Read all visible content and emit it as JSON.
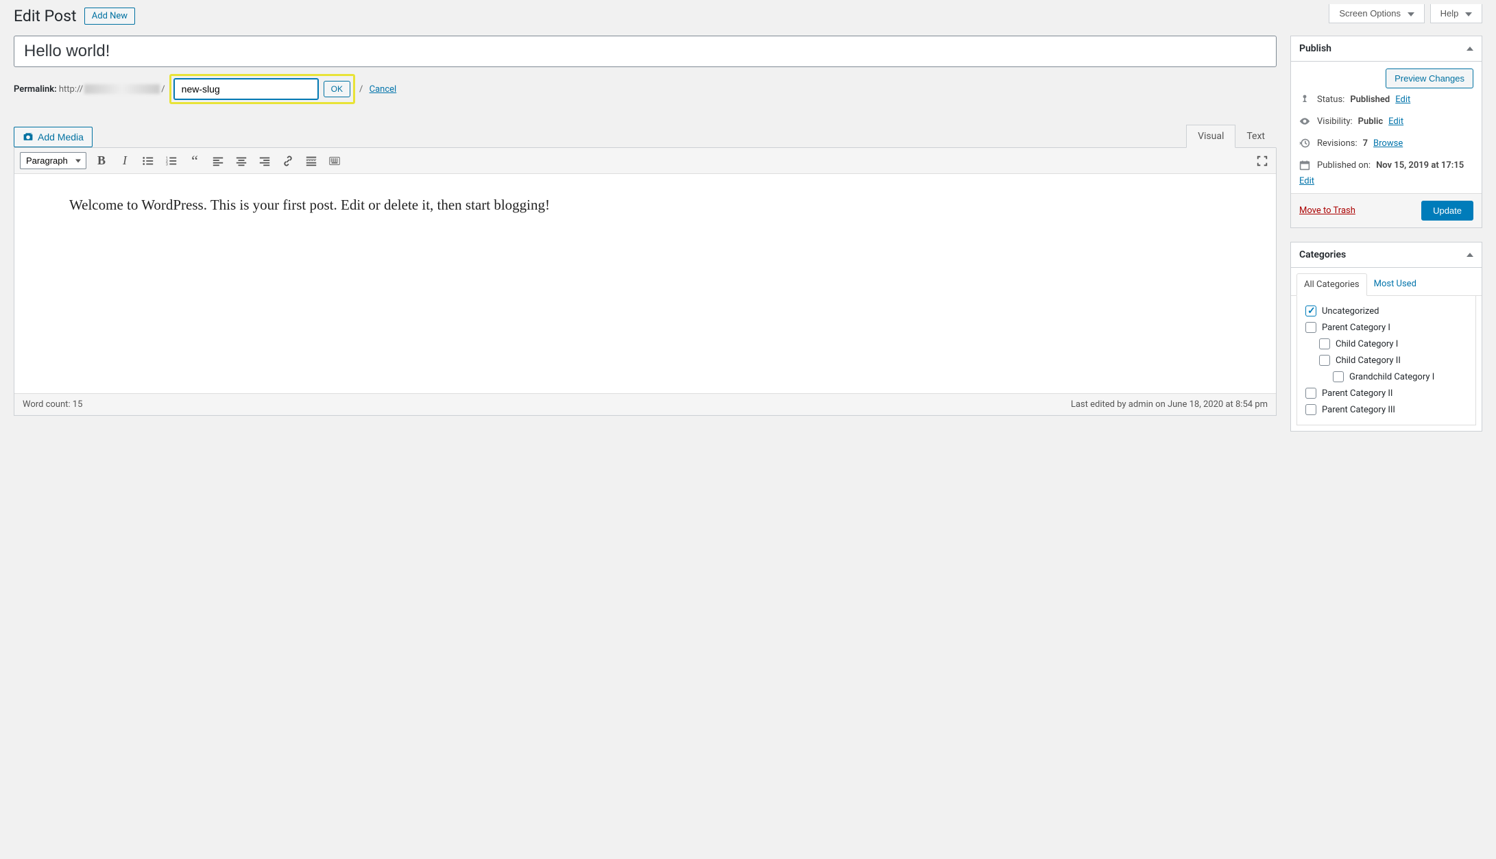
{
  "top": {
    "screen_options": "Screen Options",
    "help": "Help"
  },
  "header": {
    "title": "Edit Post",
    "add_new": "Add New"
  },
  "post": {
    "title": "Hello world!",
    "permalink_label": "Permalink:",
    "permalink_prefix": "http://",
    "slug_value": "new-slug",
    "ok": "OK",
    "cancel": "Cancel"
  },
  "editor": {
    "add_media": "Add Media",
    "tab_visual": "Visual",
    "tab_text": "Text",
    "format_select": "Paragraph",
    "content": "Welcome to WordPress. This is your first post. Edit or delete it, then start blogging!"
  },
  "status_bar": {
    "word_count_label": "Word count:",
    "word_count": "15",
    "last_edited": "Last edited by admin on June 18, 2020 at 8:54 pm"
  },
  "publish": {
    "box_title": "Publish",
    "preview": "Preview Changes",
    "status_label": "Status:",
    "status_value": "Published",
    "edit": "Edit",
    "visibility_label": "Visibility:",
    "visibility_value": "Public",
    "revisions_label": "Revisions:",
    "revisions_value": "7",
    "browse": "Browse",
    "published_label": "Published on:",
    "published_value": "Nov 15, 2019 at 17:15",
    "trash": "Move to Trash",
    "update": "Update"
  },
  "categories": {
    "box_title": "Categories",
    "tab_all": "All Categories",
    "tab_most": "Most Used",
    "items": [
      {
        "label": "Uncategorized",
        "checked": true,
        "indent": 0
      },
      {
        "label": "Parent Category I",
        "checked": false,
        "indent": 0
      },
      {
        "label": "Child Category I",
        "checked": false,
        "indent": 1
      },
      {
        "label": "Child Category II",
        "checked": false,
        "indent": 1
      },
      {
        "label": "Grandchild Category I",
        "checked": false,
        "indent": 2
      },
      {
        "label": "Parent Category II",
        "checked": false,
        "indent": 0
      },
      {
        "label": "Parent Category III",
        "checked": false,
        "indent": 0
      }
    ]
  }
}
